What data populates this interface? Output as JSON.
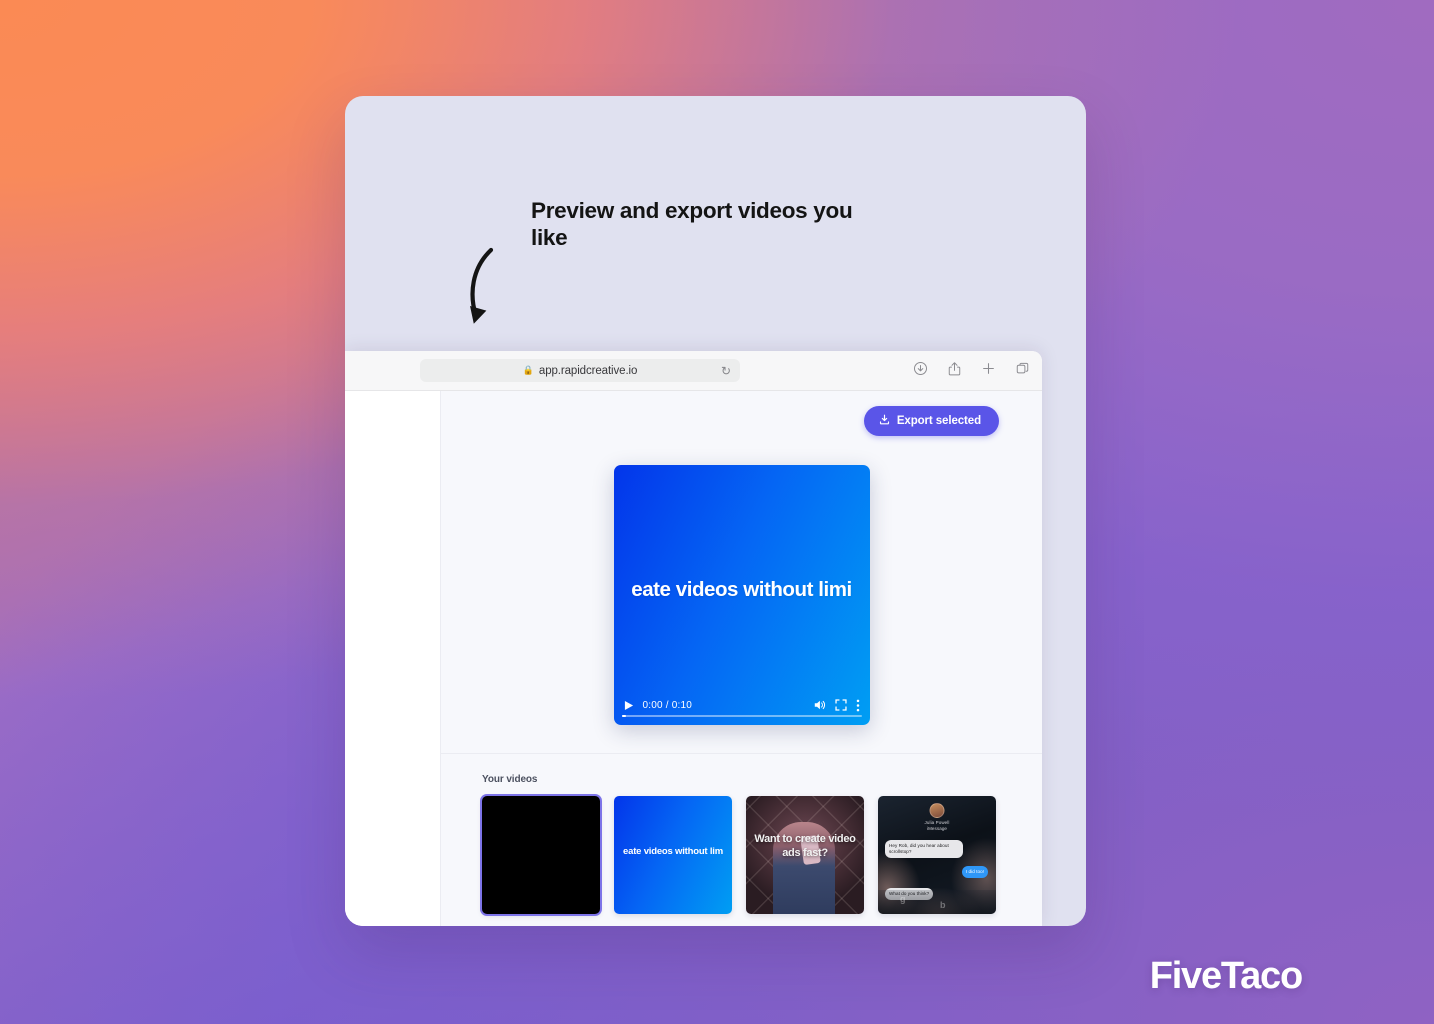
{
  "promo": {
    "headline": "Preview and export videos you like",
    "arrow_icon": "curved-arrow-down-icon"
  },
  "browser": {
    "url": "app.rapidcreative.io",
    "lock_icon": "lock-icon",
    "reload_icon": "reload-icon",
    "actions": [
      {
        "name": "downloads-icon",
        "label": "Downloads"
      },
      {
        "name": "share-icon",
        "label": "Share"
      },
      {
        "name": "new-tab-icon",
        "label": "New Tab"
      },
      {
        "name": "tabs-overview-icon",
        "label": "Tabs"
      }
    ]
  },
  "app": {
    "export_button": {
      "label": "Export selected",
      "icon": "download-icon",
      "color": "#5a55e8"
    },
    "player": {
      "caption": "eate videos without limi",
      "full_caption": "Create videos without limits",
      "time": "0:00 / 0:10",
      "current_time": "0:00",
      "duration": "0:10",
      "progress_percent": 2,
      "play_icon": "play-icon",
      "volume_icon": "volume-icon",
      "fullscreen_icon": "fullscreen-icon",
      "more_icon": "kebab-menu-icon",
      "gradient_from": "#0335ea",
      "gradient_to": "#009ef3"
    },
    "videos": {
      "label": "Your videos",
      "items": [
        {
          "name": "video-thumb-black",
          "style": "black",
          "caption": "",
          "selected": true
        },
        {
          "name": "video-thumb-blue",
          "style": "blue",
          "caption": "eate videos without lim",
          "selected": false
        },
        {
          "name": "video-thumb-person",
          "style": "person",
          "caption": "Want to create video ads fast?",
          "selected": false
        },
        {
          "name": "video-thumb-chat",
          "style": "chat",
          "caption": "",
          "selected": false
        }
      ]
    }
  },
  "chat_thumb": {
    "contact": "Julia Powell",
    "subtitle": "iMessage",
    "messages": [
      {
        "from": "them",
        "text": "Hey Rob, did you hear about scrollstop?"
      },
      {
        "from": "me",
        "text": "I did too!"
      },
      {
        "from": "them",
        "text": "What do you think?"
      }
    ]
  },
  "brand": {
    "name": "FiveTaco"
  },
  "colors": {
    "card_bg": "#e0e1f0",
    "accent": "#5a55e8",
    "selection": "#7d74e8",
    "app_bg": "#f7f8fc"
  }
}
